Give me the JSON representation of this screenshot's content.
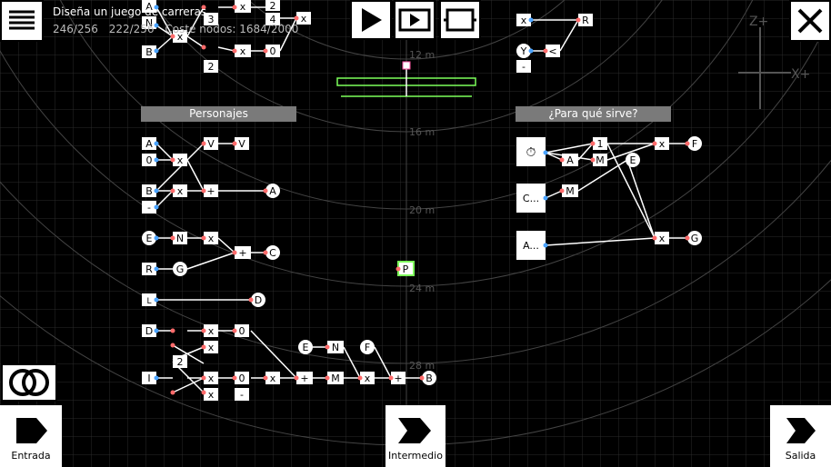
{
  "hud": {
    "title": "Diseña un juego de carreras",
    "stat_nodes": "246/256",
    "stat_links": "222/256",
    "stat_cost": "Coste nodos: 1684/2000"
  },
  "sections": {
    "left": "Personajes",
    "right": "¿Para qué sirve?"
  },
  "buttons": {
    "input": "Entrada",
    "middle": "Intermedio",
    "output": "Salida"
  },
  "meters": [
    "12 m",
    "16 m",
    "20 m",
    "24 m",
    "28 m"
  ],
  "axes": {
    "z": "Z+",
    "x": "X+"
  },
  "node_labels": {
    "A": "A",
    "B": "B",
    "C": "C",
    "D": "D",
    "E": "E",
    "F": "F",
    "G": "G",
    "M": "M",
    "N": "N",
    "P": "P",
    "R": "R",
    "V": "V",
    "x": "x",
    "plus": "+",
    "one": "1",
    "zero": "0",
    "two": "2",
    "three": "3",
    "four": "4",
    "minus": "-",
    "c_dots": "C...",
    "a_dots": "A..."
  },
  "colors": {
    "background": "#000000",
    "grid": "#2a2a2a",
    "node_fill": "#ffffff",
    "link": "#ffffff",
    "input_port": "#4aa3ff",
    "output_port": "#ff6b6b",
    "green": "#7cff5a",
    "section_bg": "#7a7a7a"
  }
}
